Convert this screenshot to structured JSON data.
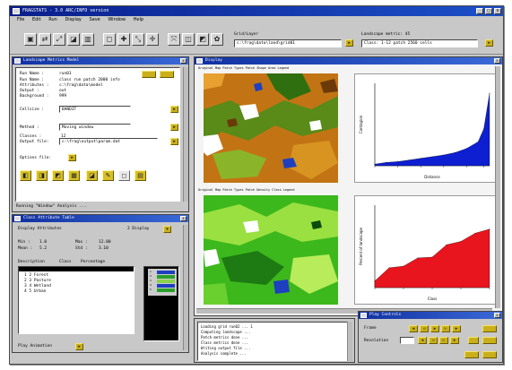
{
  "window": {
    "title": "FRAGSTATS - 3.0 ARC/INFO version",
    "minimize": "_",
    "maximize": "□",
    "close": "x"
  },
  "menu": [
    "File",
    "Edit",
    "Run",
    "Display",
    "Save",
    "Window",
    "Help"
  ],
  "toolbar": {
    "buttons": [
      "open-icon",
      "save-icon",
      "print-icon",
      "run-icon",
      "table-icon",
      "select-icon",
      "zoom-in-icon",
      "zoom-out-icon",
      "pan-icon",
      "full-extent-icon",
      "info-icon",
      "edit-icon",
      "settings-icon"
    ],
    "glyphs": [
      "▣",
      "⇄",
      "⤢",
      "◪",
      "▥",
      "◻",
      "✚",
      "⤡",
      "✛",
      "⤧",
      "◫",
      "◩",
      "✿"
    ],
    "grid_label": "Grid/Layer",
    "grid_value": "c:\\frag\\data\\land\\grid01",
    "status_label": "Landscape metric: 45",
    "status_value": "Class: 1-12 patch 2560 cells"
  },
  "left_panel": {
    "title": "Landscape Metrics Model",
    "rows": [
      {
        "label": "Run Name   :",
        "value": "run01"
      },
      {
        "label": "Run Name   :",
        "value": "class run patch 2000 info"
      },
      {
        "label": "Attributes :",
        "value": "c:\\frag\\data\\model"
      },
      {
        "label": "Output     :",
        "value": "out"
      },
      {
        "label": "Background :",
        "value": "999"
      }
    ],
    "fields": [
      {
        "label": "Cellsize   :",
        "value": "BANDIT"
      },
      {
        "label": "Method     :",
        "value": "Moving window"
      },
      {
        "label": "Classes    :",
        "value": "12"
      },
      {
        "label": "Output file:",
        "value": "c:\\frag\\output\\param.dat"
      }
    ],
    "option_label": "Options file:",
    "footer": "Running  \"Window\"  Analysis ...",
    "icon_glyphs": [
      "◧",
      "◨",
      "◩",
      "▦",
      "◪",
      "✎",
      "◻",
      "▤"
    ]
  },
  "lower_panel": {
    "title": "Class Attribute Table",
    "sub1": "Display Attributes",
    "sub1_val": "2 Display",
    "row1": [
      "Min  :",
      "1.0",
      "Max  :",
      "12.00"
    ],
    "row2": [
      "Mean :",
      "5.2",
      "Std  :",
      "3.10"
    ],
    "list_headers": [
      "Description",
      "Class",
      "Percentage"
    ],
    "list_items": [
      "1   2 Forest",
      "2   3 Pasture",
      "3   4 Wetland",
      "4   5 Urban"
    ],
    "legend_labels": [
      "1",
      "2",
      "3",
      "4",
      "5",
      "6"
    ],
    "footer": "Play Animation"
  },
  "display": {
    "title": "Display",
    "map1_title": "Original Map  Patch Types  Patch Shape  Area  Legend",
    "map2_title": "Original Map  Patch Types  Patch Density  Class  Legend",
    "console_lines": [
      "Loading grid run02 ...      1",
      "Computing landscape ...",
      "Patch metrics done ...",
      "Class metrics done ...",
      "Writing output file ...",
      "Analysis complete ..."
    ]
  },
  "mini_panel": {
    "title": "Play Controls",
    "row1_label": "Frame",
    "row2_label": "Resolution",
    "row2_value": ""
  },
  "colors": {
    "title_blue": "#0a1f8c",
    "chart1_fill": "#0d1fd0",
    "chart2_fill": "#e8141e",
    "button_yellow": "#d8c028"
  },
  "chart_data": [
    {
      "type": "area",
      "title": "",
      "x": [
        0,
        20,
        40,
        60,
        80,
        100,
        120,
        140,
        160,
        180,
        190,
        200
      ],
      "values": [
        2,
        4,
        5,
        7,
        9,
        11,
        13,
        16,
        21,
        29,
        45,
        88
      ],
      "xlabel": "Distance",
      "ylabel": "Contagion",
      "ylim": [
        0,
        100
      ],
      "color": "#0d1fd0"
    },
    {
      "type": "area",
      "title": "",
      "x": [
        0,
        1,
        2,
        3,
        4,
        5,
        6,
        7,
        8
      ],
      "values": [
        8,
        24,
        26,
        36,
        37,
        52,
        56,
        66,
        71
      ],
      "xlabel": "Class",
      "ylabel": "Percent of landscape",
      "ylim": [
        0,
        100
      ],
      "color": "#e8141e"
    }
  ]
}
